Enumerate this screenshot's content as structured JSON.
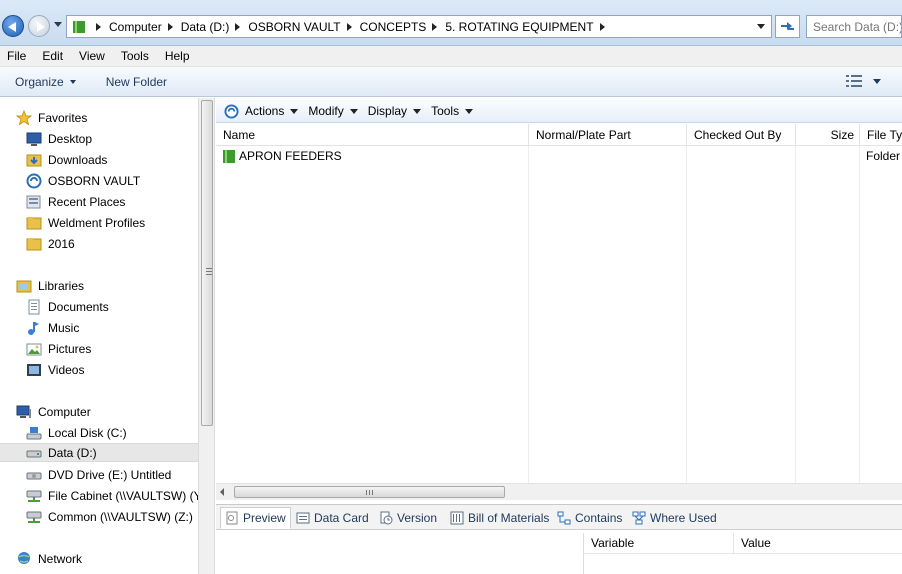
{
  "address": {
    "crumbs": [
      "Computer",
      "Data (D:)",
      "OSBORN VAULT",
      "CONCEPTS",
      "5. ROTATING EQUIPMENT"
    ],
    "search_placeholder": "Search Data (D:)"
  },
  "menu": [
    "File",
    "Edit",
    "View",
    "Tools",
    "Help"
  ],
  "commandbar": {
    "organize": "Organize",
    "new_folder": "New Folder"
  },
  "nav": {
    "favorites": {
      "label": "Favorites",
      "items": [
        "Desktop",
        "Downloads",
        "OSBORN VAULT",
        "Recent Places",
        "Weldment Profiles",
        "2016"
      ]
    },
    "libraries": {
      "label": "Libraries",
      "items": [
        "Documents",
        "Music",
        "Pictures",
        "Videos"
      ]
    },
    "computer": {
      "label": "Computer",
      "items": [
        "Local Disk (C:)",
        "Data (D:)",
        "DVD Drive (E:) Untitled",
        "File Cabinet (\\\\VAULTSW) (Y",
        "Common (\\\\VAULTSW) (Z:)"
      ]
    },
    "network": {
      "label": "Network"
    },
    "selected": "Data (D:)"
  },
  "vaultbar": [
    "Actions",
    "Modify",
    "Display",
    "Tools"
  ],
  "columns": [
    "Name",
    "Normal/Plate Part",
    "Checked Out By",
    "Size",
    "File Typ"
  ],
  "rows": [
    {
      "name": "APRON FEEDERS",
      "type": "Folder"
    }
  ],
  "tabs": [
    "Preview",
    "Data Card",
    "Version",
    "Bill of Materials",
    "Contains",
    "Where Used"
  ],
  "preview_table": {
    "variable": "Variable",
    "value": "Value"
  },
  "colors": {
    "folder_green": "#3d9a2e",
    "folder_yellow": "#e8c04a",
    "accent": "#1e395b"
  }
}
